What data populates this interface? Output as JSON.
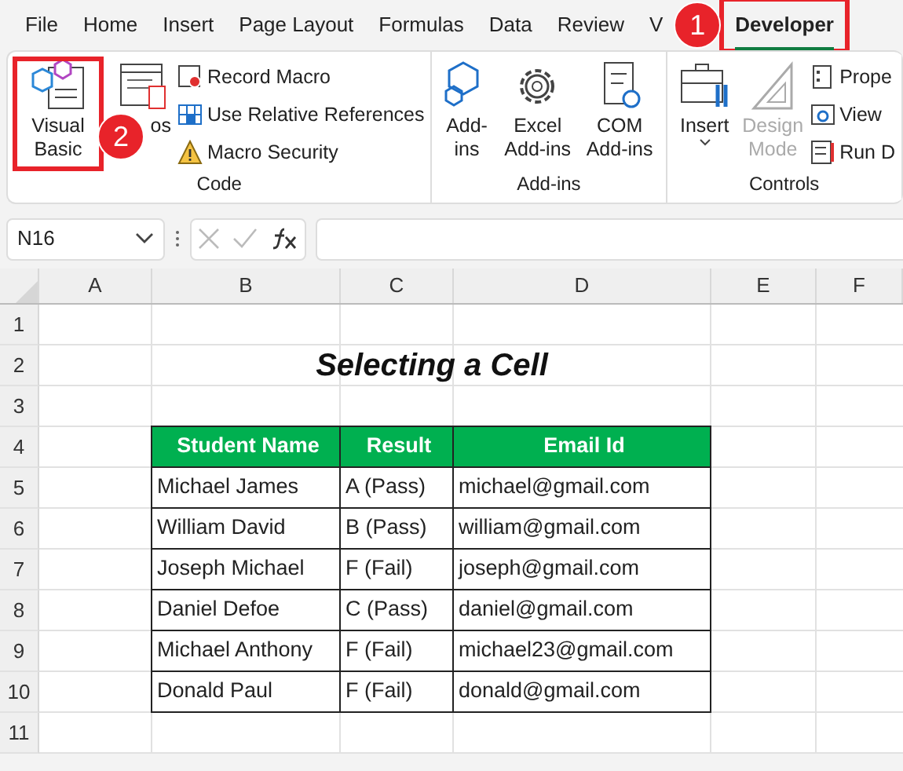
{
  "tabs": [
    {
      "label": "File",
      "selected": false
    },
    {
      "label": "Home",
      "selected": false
    },
    {
      "label": "Insert",
      "selected": false
    },
    {
      "label": "Page Layout",
      "selected": false
    },
    {
      "label": "Formulas",
      "selected": false
    },
    {
      "label": "Data",
      "selected": false
    },
    {
      "label": "Review",
      "selected": false
    },
    {
      "label": "V",
      "selected": false
    },
    {
      "label": "Developer",
      "selected": true
    }
  ],
  "ribbon": {
    "groups": [
      {
        "name": "Code",
        "large_buttons": [
          {
            "kind": "vb",
            "label": "Visual Basic",
            "disabled": false
          },
          {
            "kind": "macros",
            "label": "os",
            "disabled": false
          }
        ],
        "small_buttons": [
          {
            "kind": "record",
            "label": "Record Macro"
          },
          {
            "kind": "relative",
            "label": "Use Relative References"
          },
          {
            "kind": "security",
            "label": "Macro Security"
          }
        ]
      },
      {
        "name": "Add-ins",
        "large_buttons": [
          {
            "kind": "addins",
            "label": "Add-ins",
            "disabled": false
          },
          {
            "kind": "gear",
            "label": "Excel Add-ins",
            "disabled": false
          },
          {
            "kind": "com",
            "label": "COM Add-ins",
            "disabled": false
          }
        ]
      },
      {
        "name": "Controls",
        "large_buttons": [
          {
            "kind": "insert",
            "label": "Insert",
            "disabled": false,
            "dropdown": true
          },
          {
            "kind": "design",
            "label": "Design Mode",
            "disabled": true
          }
        ],
        "small_buttons": [
          {
            "kind": "props",
            "label": "Prope"
          },
          {
            "kind": "view",
            "label": "View"
          },
          {
            "kind": "run",
            "label": "Run D"
          }
        ]
      }
    ]
  },
  "callouts": [
    {
      "number": "1"
    },
    {
      "number": "2"
    }
  ],
  "name_box": "N16",
  "column_headers": [
    "A",
    "B",
    "C",
    "D",
    "E",
    "F"
  ],
  "row_headers": [
    "1",
    "2",
    "3",
    "4",
    "5",
    "6",
    "7",
    "8",
    "9",
    "10",
    "11"
  ],
  "title": "Selecting a Cell",
  "table": {
    "columns": [
      "Student Name",
      "Result",
      "Email Id"
    ],
    "rows": [
      [
        "Michael James",
        "A (Pass)",
        "michael@gmail.com"
      ],
      [
        "William David",
        "B (Pass)",
        "william@gmail.com"
      ],
      [
        "Joseph Michael",
        "F (Fail)",
        "joseph@gmail.com"
      ],
      [
        "Daniel Defoe",
        "C (Pass)",
        "daniel@gmail.com"
      ],
      [
        "Michael Anthony",
        "F (Fail)",
        "michael23@gmail.com"
      ],
      [
        "Donald Paul",
        "F (Fail)",
        "donald@gmail.com"
      ]
    ]
  }
}
